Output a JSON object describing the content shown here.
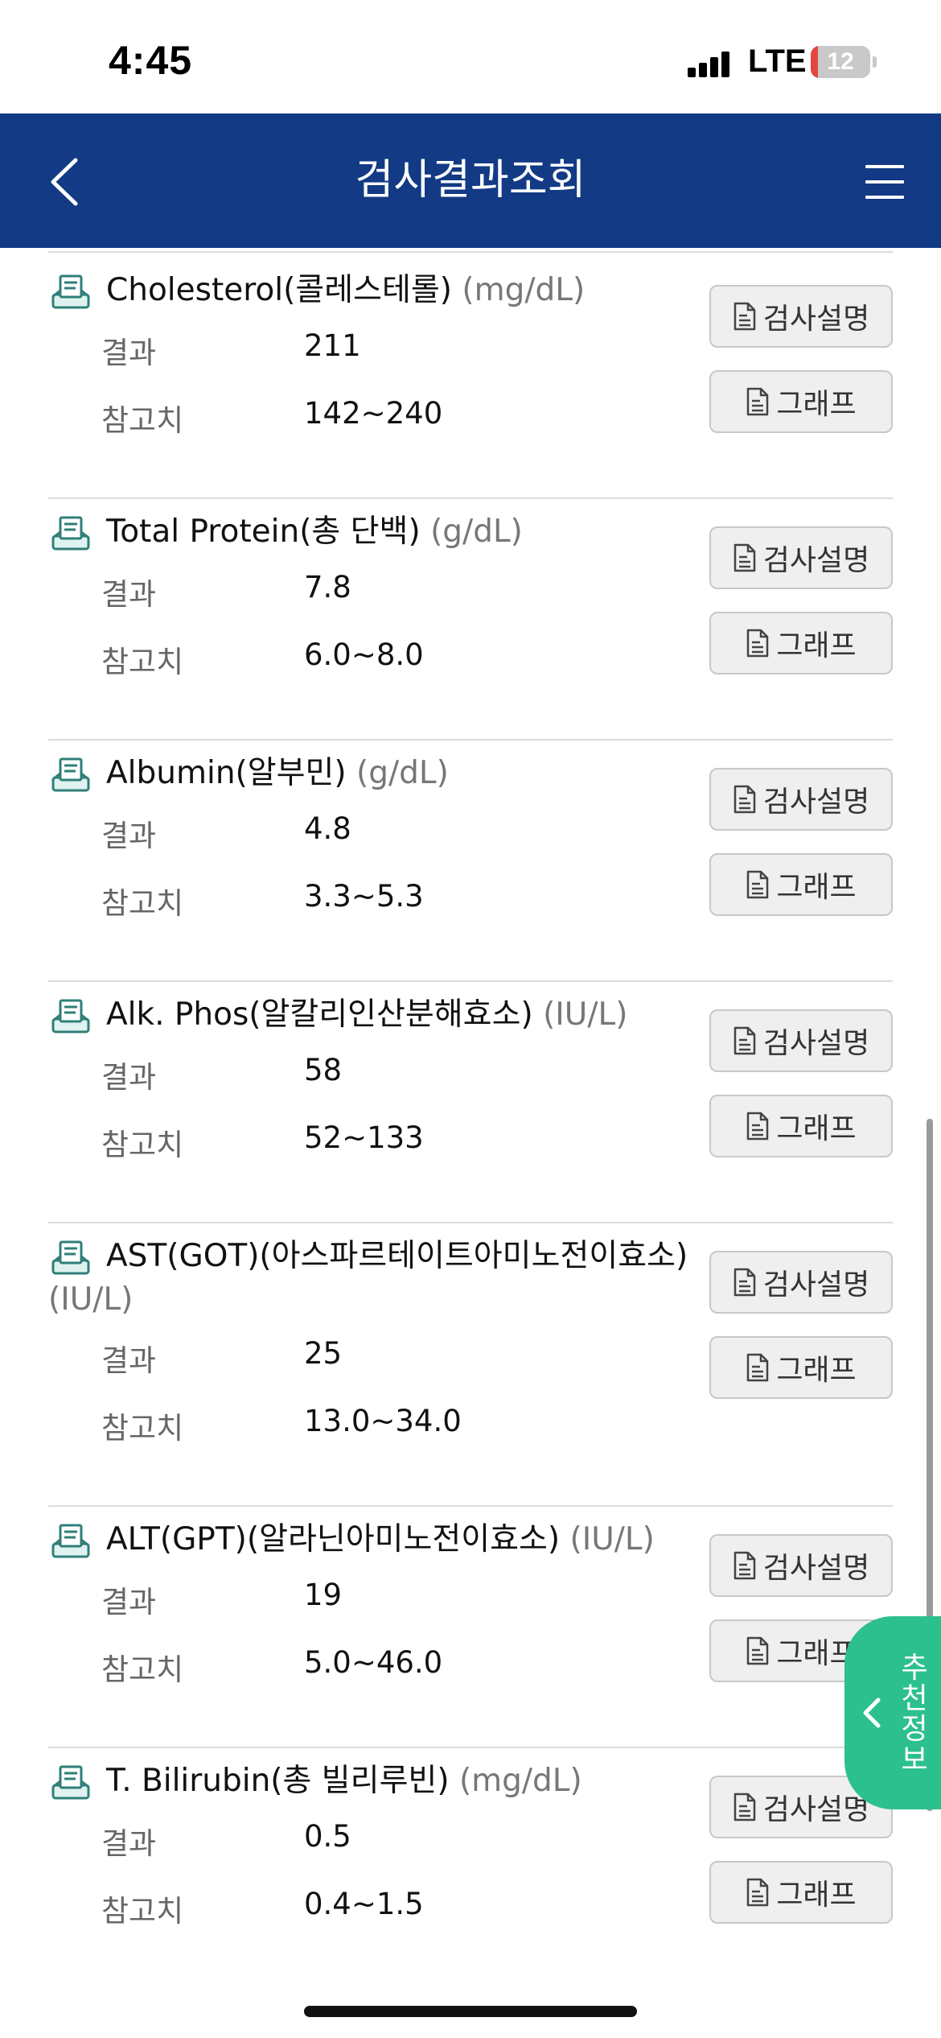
{
  "status_bar": {
    "time": "4:45",
    "network": "LTE",
    "battery": "12",
    "battery_level": 0.12
  },
  "header": {
    "title": "검사결과조회"
  },
  "labels": {
    "result": "결과",
    "reference": "참고치"
  },
  "buttons": {
    "description": "검사설명",
    "graph": "그래프"
  },
  "tests": [
    {
      "name": "Cholesterol(콜레스테롤)",
      "unit": "(mg/dL)",
      "result": "211",
      "reference": "142~240"
    },
    {
      "name": "Total Protein(총 단백)",
      "unit": "(g/dL)",
      "result": "7.8",
      "reference": "6.0~8.0"
    },
    {
      "name": "Albumin(알부민)",
      "unit": "(g/dL)",
      "result": "4.8",
      "reference": "3.3~5.3"
    },
    {
      "name": "Alk. Phos(알칼리인산분해효소)",
      "unit": "(IU/L)",
      "result": "58",
      "reference": "52~133"
    },
    {
      "name": "AST(GOT)(아스파르테이트아미노전이효소)",
      "unit": "(IU/L)",
      "result": "25",
      "reference": "13.0~34.0"
    },
    {
      "name": "ALT(GPT)(알라닌아미노전이효소)",
      "unit": "(IU/L)",
      "result": "19",
      "reference": "5.0~46.0"
    },
    {
      "name": "T. Bilirubin(총 빌리루빈)",
      "unit": "(mg/dL)",
      "result": "0.5",
      "reference": "0.4~1.5"
    }
  ],
  "recommend_tab": {
    "label": "추천정보"
  },
  "icons": {
    "back": "chevron-left-icon",
    "menu": "hamburger-menu-icon",
    "item": "report-tray-icon",
    "button": "document-icon",
    "recommend": "chevron-left-icon"
  },
  "colors": {
    "header_bg": "#123a85",
    "recommend_tab": "#2dc08f",
    "battery_low": "#e5453f"
  }
}
